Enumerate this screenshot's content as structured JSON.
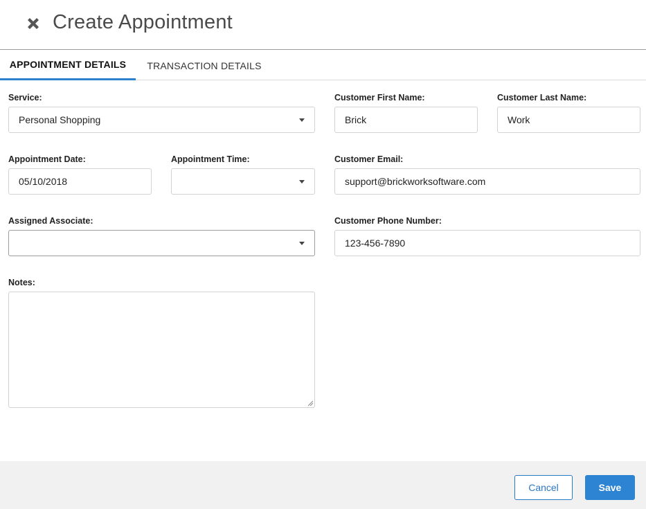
{
  "dialog": {
    "title": "Create Appointment",
    "close_icon": "close-x-icon"
  },
  "tabs": [
    {
      "label": "APPOINTMENT DETAILS",
      "active": true
    },
    {
      "label": "TRANSACTION DETAILS",
      "active": false
    }
  ],
  "form": {
    "service": {
      "label": "Service:",
      "value": "Personal Shopping"
    },
    "first_name": {
      "label": "Customer First Name:",
      "value": "Brick"
    },
    "last_name": {
      "label": "Customer Last Name:",
      "value": "Work"
    },
    "appointment_date": {
      "label": "Appointment Date:",
      "value": "05/10/2018"
    },
    "appointment_time": {
      "label": "Appointment Time:",
      "value": ""
    },
    "email": {
      "label": "Customer Email:",
      "value": "support@brickworksoftware.com"
    },
    "associate": {
      "label": "Assigned Associate:",
      "value": ""
    },
    "phone": {
      "label": "Customer Phone Number:",
      "value": "123-456-7890"
    },
    "notes": {
      "label": "Notes:",
      "value": ""
    }
  },
  "footer": {
    "cancel_label": "Cancel",
    "save_label": "Save"
  },
  "colors": {
    "accent": "#2d84d2",
    "tab_indicator": "#2d7fd0",
    "footer_bg": "#f1f1f1"
  }
}
